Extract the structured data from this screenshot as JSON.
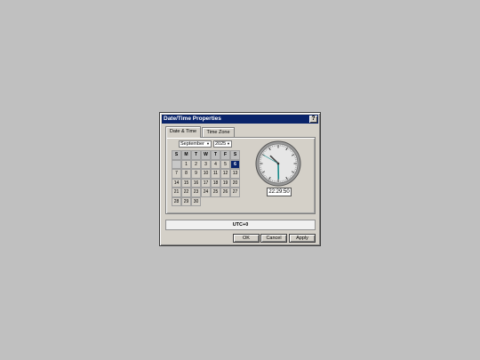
{
  "window": {
    "title": "Date/Time Properties",
    "help_label": "?"
  },
  "tabs": [
    {
      "label": "Date & Time",
      "active": true
    },
    {
      "label": "Time Zone",
      "active": false
    }
  ],
  "date": {
    "month": "September",
    "year": "2025",
    "weekday_headers": [
      "S",
      "M",
      "T",
      "W",
      "T",
      "F",
      "S"
    ],
    "first_day_offset": 1,
    "days_in_month": 30,
    "selected_day": 6
  },
  "clock": {
    "time_text": "22:29:50",
    "hour": 22,
    "minute": 29,
    "second": 50,
    "hand_color": "#1a8a8a"
  },
  "timezone_label": "UTC+0",
  "buttons": {
    "ok": "OK",
    "cancel": "Cancel",
    "apply": "Apply"
  },
  "colors": {
    "desktop": "#c0c0c0",
    "titlebar": "#0a246a",
    "selected_day": "#0a246a"
  }
}
